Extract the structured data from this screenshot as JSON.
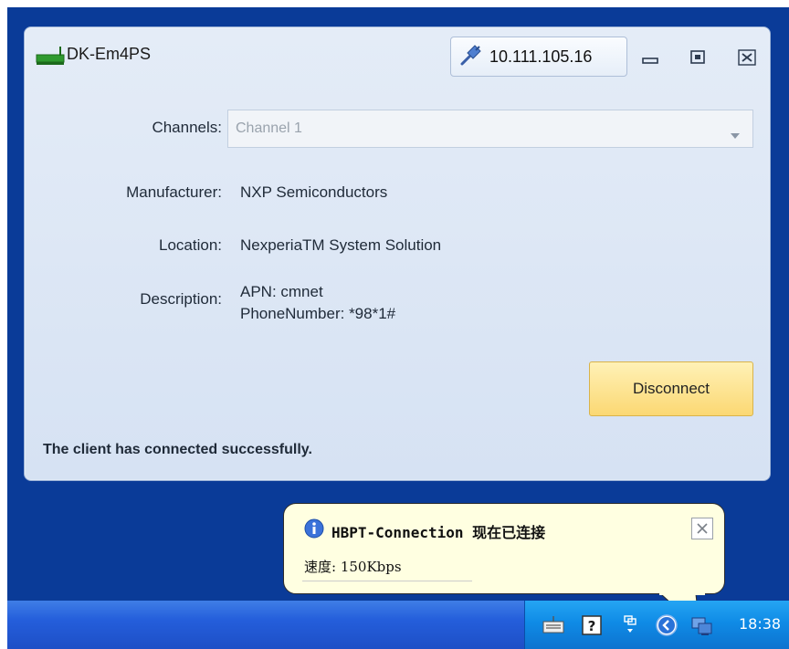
{
  "window": {
    "title": "DK-Em4PS",
    "ip_address": "10.111.105.16"
  },
  "form": {
    "channels_label": "Channels:",
    "channels_value": "Channel 1",
    "manufacturer_label": "Manufacturer:",
    "manufacturer_value": "NXP Semiconductors",
    "location_label": "Location:",
    "location_value": "NexperiaTM System Solution",
    "description_label": "Description:",
    "description_line1": "APN: cmnet",
    "description_line2": "PhoneNumber: *98*1#",
    "disconnect_label": "Disconnect"
  },
  "status": {
    "message": "The client has connected successfully."
  },
  "balloon": {
    "title": "HBPT-Connection 现在已连接",
    "speed": "速度: 150Kbps"
  },
  "taskbar": {
    "clock": "18:38"
  },
  "colors": {
    "desktop": "#0a3b98",
    "window_bg": "#dce6f4",
    "disconnect_button": "#fbd873",
    "balloon_bg": "#ffffe1",
    "taskbar": "#245edb"
  },
  "icons": [
    "network-adapter-icon",
    "plug-icon",
    "minimize-icon",
    "maximize-icon",
    "close-icon",
    "dropdown-arrow-icon",
    "info-icon",
    "keyboard-icon",
    "help-icon",
    "network-connections-icon",
    "show-hidden-icons-icon",
    "network-status-icon"
  ]
}
